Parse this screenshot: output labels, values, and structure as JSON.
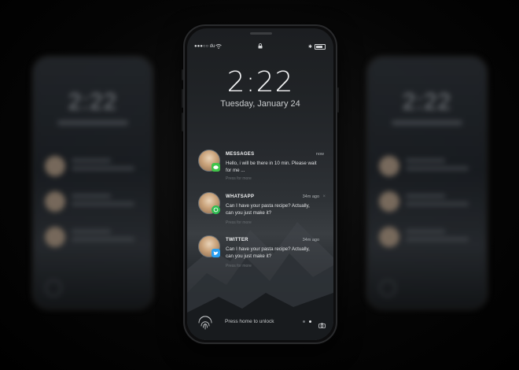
{
  "status_bar": {
    "carrier": "●●●○○ du",
    "wifi_icon": "wifi-icon",
    "lock_icon": "lock-icon",
    "bluetooth": "✱"
  },
  "lock_screen": {
    "time": "2:22",
    "date": "Tuesday, January 24"
  },
  "notifications": [
    {
      "app": "MESSAGES",
      "time": "now",
      "text": "Hello, i will be there in 10 min. Please wait for me ...",
      "hint": "Press for more",
      "icon": "messages-app-icon",
      "color": "#41c34a"
    },
    {
      "app": "WHATSAPP",
      "time": "34m ago",
      "text": "Can I have your pasta recipe? Actually, can you just make it?",
      "hint": "Press for more",
      "icon": "whatsapp-app-icon",
      "color": "#2fbd51"
    },
    {
      "app": "TWITTER",
      "time": "34m ago",
      "text": "Can I have your pasta recipe? Actually, can you just make it?",
      "hint": "Press for more",
      "icon": "twitter-app-icon",
      "color": "#2a9ff0"
    }
  ],
  "footer": {
    "unlock_text": "Press home to unlock",
    "page_count": 2,
    "current_page": 2,
    "camera_icon": "camera-icon",
    "fingerprint_icon": "fingerprint-icon"
  },
  "side_phones": {
    "left_time": "2:22",
    "right_time": "2:22"
  }
}
